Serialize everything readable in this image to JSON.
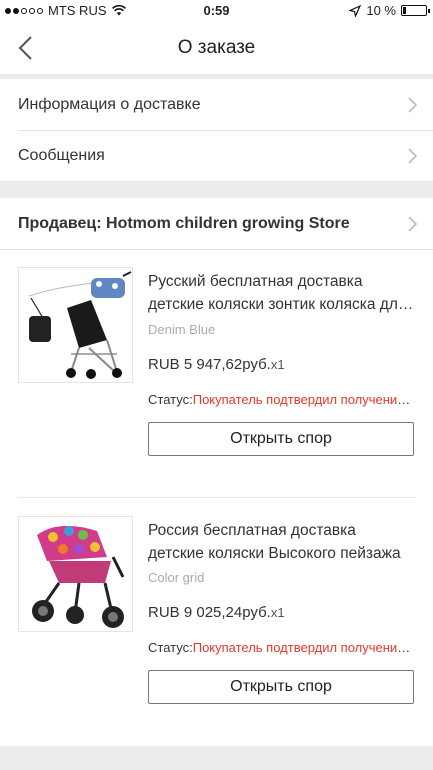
{
  "status_bar": {
    "carrier": "MTS RUS",
    "time": "0:59",
    "battery": "10 %",
    "signal_bars_filled": 2,
    "battery_level": 0.1
  },
  "nav": {
    "title": "О заказе",
    "back_icon": "chevron-left-icon"
  },
  "menu": {
    "delivery_info": "Информация о доставке",
    "messages": "Сообщения"
  },
  "seller": {
    "label": "Продавец: Hotmom children growing Store"
  },
  "products": [
    {
      "title": "Русский бесплатная доставка детские коляски зонтик коляска для ребенка",
      "title_line1": "Русский бесплатная доставка",
      "title_line2": "детские коляски зонтик коляска для ребенка",
      "variant": "Denim Blue",
      "price": "RUB 5 947,62руб.",
      "qty": "x1",
      "status_label": "Статус:",
      "status_value": "Покупатель подтвердил получение товара",
      "dispute_button": "Открыть спор"
    },
    {
      "title": "Россия бесплатная доставка детские коляски Высокого пейзажа",
      "title_line1": "Россия бесплатная доставка",
      "title_line2": "детские коляски Высокого пейзажа",
      "variant": "Color grid",
      "price": "RUB 9 025,24руб.",
      "qty": "x1",
      "status_label": "Статус:",
      "status_value": "Покупатель подтвердил получение товара",
      "dispute_button": "Открыть спор"
    }
  ],
  "colors": {
    "accent_red": "#e4392b",
    "band_gray": "#ececec"
  }
}
